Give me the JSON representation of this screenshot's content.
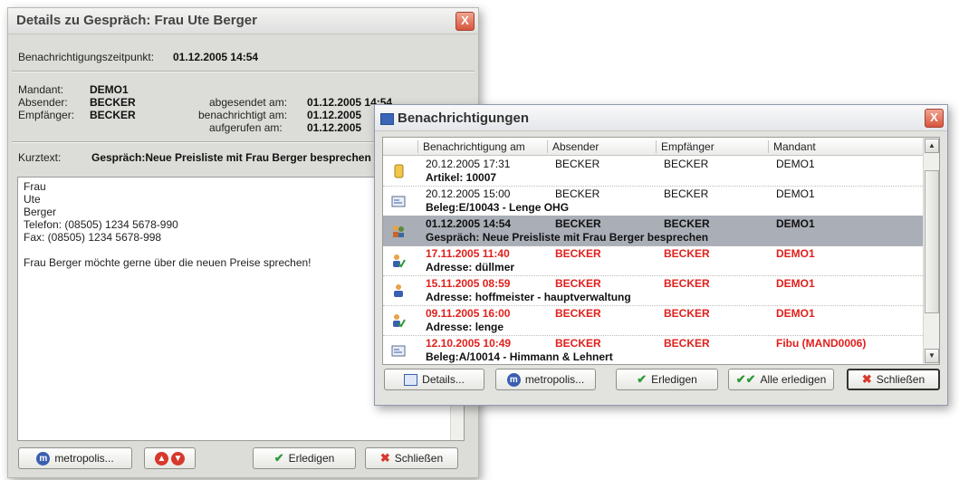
{
  "details": {
    "title": "Details zu Gespräch: Frau Ute Berger",
    "close_label": "X",
    "notify_time_label": "Benachrichtigungszeitpunkt:",
    "notify_time_value": "01.12.2005 14:54",
    "mandant_label": "Mandant:",
    "mandant_value": "DEMO1",
    "sender_label": "Absender:",
    "sender_value": "BECKER",
    "recipient_label": "Empfänger:",
    "recipient_value": "BECKER",
    "sent_label": "abgesendet am:",
    "sent_value": "01.12.2005 14:54",
    "notified_label": "benachrichtigt am:",
    "notified_value": "01.12.2005",
    "opened_label": "aufgerufen am:",
    "opened_value": "01.12.2005",
    "short_label": "Kurztext:",
    "short_value": "Gespräch:Neue Preisliste mit Frau Berger besprechen",
    "memo_lines": [
      "Frau",
      "Ute",
      "Berger",
      "Telefon: (08505) 1234 5678-990",
      "Fax: (08505) 1234 5678-998",
      "",
      "Frau Berger möchte gerne über die neuen Preise sprechen!"
    ],
    "buttons": {
      "metropolis": "metropolis...",
      "up": "up",
      "down": "down",
      "done": "Erledigen",
      "close": "Schließen"
    }
  },
  "notifications": {
    "title": "Benachrichtigungen",
    "close_label": "X",
    "columns": [
      "Benachrichtigung am",
      "Absender",
      "Empfänger",
      "Mandant"
    ],
    "rows": [
      {
        "date": "20.12.2005 17:31",
        "sender": "BECKER",
        "recipient": "BECKER",
        "mandant": "DEMO1",
        "desc": "Artikel: 10007",
        "style": "normal",
        "icon": "article-icon"
      },
      {
        "date": "20.12.2005 15:00",
        "sender": "BECKER",
        "recipient": "BECKER",
        "mandant": "DEMO1",
        "desc": "Beleg:E/10043 - Lenge OHG",
        "style": "normal",
        "icon": "document-icon"
      },
      {
        "date": "01.12.2005 14:54",
        "sender": "BECKER",
        "recipient": "BECKER",
        "mandant": "DEMO1",
        "desc": "Gespräch: Neue Preisliste mit Frau Berger besprechen",
        "style": "selected",
        "icon": "conversation-icon"
      },
      {
        "date": "17.11.2005 11:40",
        "sender": "BECKER",
        "recipient": "BECKER",
        "mandant": "DEMO1",
        "desc": "Adresse: düllmer",
        "style": "overdue",
        "icon": "person-check-icon"
      },
      {
        "date": "15.11.2005 08:59",
        "sender": "BECKER",
        "recipient": "BECKER",
        "mandant": "DEMO1",
        "desc": "Adresse: hoffmeister - hauptverwaltung",
        "style": "overdue",
        "icon": "person-icon"
      },
      {
        "date": "09.11.2005 16:00",
        "sender": "BECKER",
        "recipient": "BECKER",
        "mandant": "DEMO1",
        "desc": "Adresse: lenge",
        "style": "overdue",
        "icon": "person-check-icon"
      },
      {
        "date": "12.10.2005 10:49",
        "sender": "BECKER",
        "recipient": "BECKER",
        "mandant": "Fibu (MAND0006)",
        "desc": "Beleg:A/10014 - Himmann & Lehnert",
        "style": "overdue",
        "icon": "document-icon"
      }
    ],
    "buttons": {
      "details": "Details...",
      "metropolis": "metropolis...",
      "done": "Erledigen",
      "done_all": "Alle erledigen",
      "close": "Schließen"
    }
  },
  "colors": {
    "overdue": "#e0201c",
    "selected": "#a9aeb7",
    "accent": "#3a5fb0"
  }
}
